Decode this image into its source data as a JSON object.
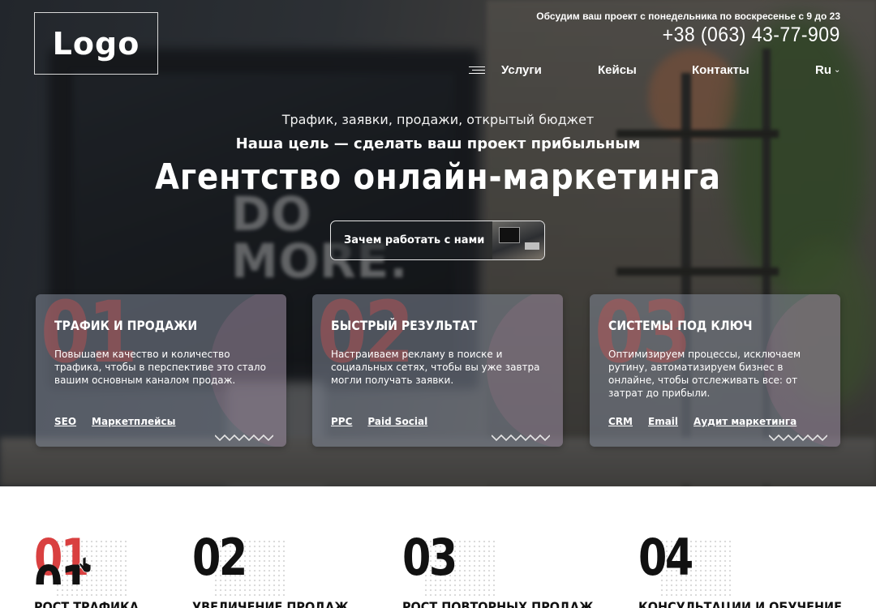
{
  "header": {
    "logo_text": "Logo",
    "schedule": "Обсудим ваш проект с понедельника по воскресенье с 9 до 23",
    "phone": "+38 (063) 43-77-909",
    "nav": {
      "services": "Услуги",
      "cases": "Кейсы",
      "contacts": "Контакты",
      "language": "Ru"
    }
  },
  "hero": {
    "background_text": "DO MORE.",
    "tagline": "Трафик, заявки, продажи, открытый бюджет",
    "goal": "Наша цель — сделать ваш проект прибыльным",
    "title": "Агентство онлайн-маркетинга",
    "cta_label": "Зачем работать с нами"
  },
  "cards": [
    {
      "number": "01",
      "title": "ТРАФИК И ПРОДАЖИ",
      "text": "Повышаем качество и количество трафика, чтобы в перспективе это стало вашим основным каналом продаж.",
      "links": [
        "SEO",
        "Маркетплейсы"
      ]
    },
    {
      "number": "02",
      "title": "БЫСТРЫЙ РЕЗУЛЬТАТ",
      "text": "Настраиваем рекламу в поиске и социальных сетях, чтобы вы уже завтра могли получать заявки.",
      "links": [
        "PPC",
        "Paid Social"
      ]
    },
    {
      "number": "03",
      "title": "СИСТЕМЫ ПОД КЛЮЧ",
      "text": "Оптимизируем процессы, исключаем рутину, автоматизируем бизнес в онлайне, чтобы отслеживать все: от затрат до прибыли.",
      "links": [
        "CRM",
        "Email",
        "Аудит маркетинга"
      ]
    }
  ],
  "stats": [
    {
      "number": "01",
      "label": "РОСТ ТРАФИКА",
      "active": true
    },
    {
      "number": "02",
      "label": "УВЕЛИЧЕНИЕ ПРОДАЖ",
      "active": false
    },
    {
      "number": "03",
      "label": "РОСТ ПОВТОРНЫХ ПРОДАЖ",
      "active": false
    },
    {
      "number": "04",
      "label": "КОНСУЛЬТАЦИИ И ОБУЧЕНИЕ",
      "active": false
    }
  ],
  "colors": {
    "accent_red": "#d94040",
    "text_dark": "#111111",
    "card_bg": "rgba(128,134,150,0.55)"
  },
  "icons": [
    "hamburger-menu-icon",
    "chevron-down-icon",
    "zigzag-wave-icon",
    "hand-pointer-cursor-icon"
  ]
}
